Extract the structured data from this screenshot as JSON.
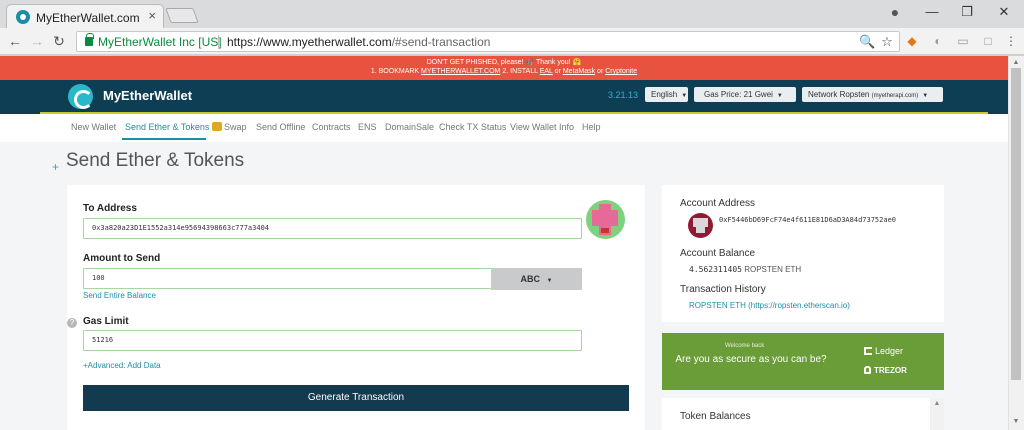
{
  "browser": {
    "tab_title": "MyEtherWallet.com",
    "tab_close": "×",
    "cert_name": "MyEtherWallet Inc [US]",
    "url_origin": "https://www.myetherwallet.com",
    "url_path": "/#send-transaction",
    "icons": [
      "back-icon",
      "forward-icon",
      "reload-icon",
      "lock-icon",
      "zoom-icon",
      "star-icon",
      "metamask-icon",
      "extension-icon",
      "menu-icon"
    ]
  },
  "window_controls": {
    "minimize": "—",
    "maximize": "❐",
    "close": "✕"
  },
  "banner": {
    "line1": "DON'T GET PHISHED, please! 🎣 Thank you! 🤗",
    "prefix": "1. BOOKMARK ",
    "bookmark_link": "MYETHERWALLET.COM",
    "step2": "  2. INSTALL ",
    "eal_link": "EAL",
    "or1": " or ",
    "metamask_link": "MetaMask",
    "or2": " or ",
    "cryptonite_link": "Cryptonite"
  },
  "header": {
    "logo_text": "MyEtherWallet",
    "version": "3.21.13",
    "language": "English",
    "gas_price": "Gas Price: 21 Gwei",
    "network": "Network Ropsten",
    "network_sub": "(myetherapi.com)"
  },
  "subnav": {
    "items": [
      "New Wallet",
      "Send Ether & Tokens",
      "Swap",
      "Send Offline",
      "Contracts",
      "ENS",
      "DomainSale",
      "Check TX Status",
      "View Wallet Info",
      "Help"
    ],
    "active": "Send Ether & Tokens"
  },
  "page": {
    "plus": "+",
    "title": "Send Ether & Tokens"
  },
  "form": {
    "to_label": "To Address",
    "to_value": "0x3a820a23D1E1552a314e95694398663c777a3404",
    "amount_label": "Amount to Send",
    "amount_value": "100",
    "currency": "ABC",
    "send_entire": "Send Entire Balance",
    "gas_label": "Gas Limit",
    "gas_value": "51216",
    "advanced": "+Advanced: Add Data",
    "generate": "Generate Transaction",
    "help": "?"
  },
  "account": {
    "address_label": "Account Address",
    "address": "0xF5446bD69FcF74e4f611E81D6aD3A84d73752ae0",
    "balance_label": "Account Balance",
    "balance_value": "4.562311405",
    "balance_unit": " ROPSTEN ETH",
    "history_label": "Transaction History",
    "history_link": "ROPSTEN ETH (https://ropsten.etherscan.io)"
  },
  "promo": {
    "welcome": "Welcome back",
    "question": "Are you as secure as you can be?",
    "ledger": "Ledger",
    "trezor": "TREZOR"
  },
  "tokens": {
    "title": "Token Balances"
  },
  "colors": {
    "banner": "#e8533f",
    "header": "#0e3e54",
    "accent": "#1f8ea4",
    "promo": "#6a9c38",
    "button": "#133a4e"
  }
}
